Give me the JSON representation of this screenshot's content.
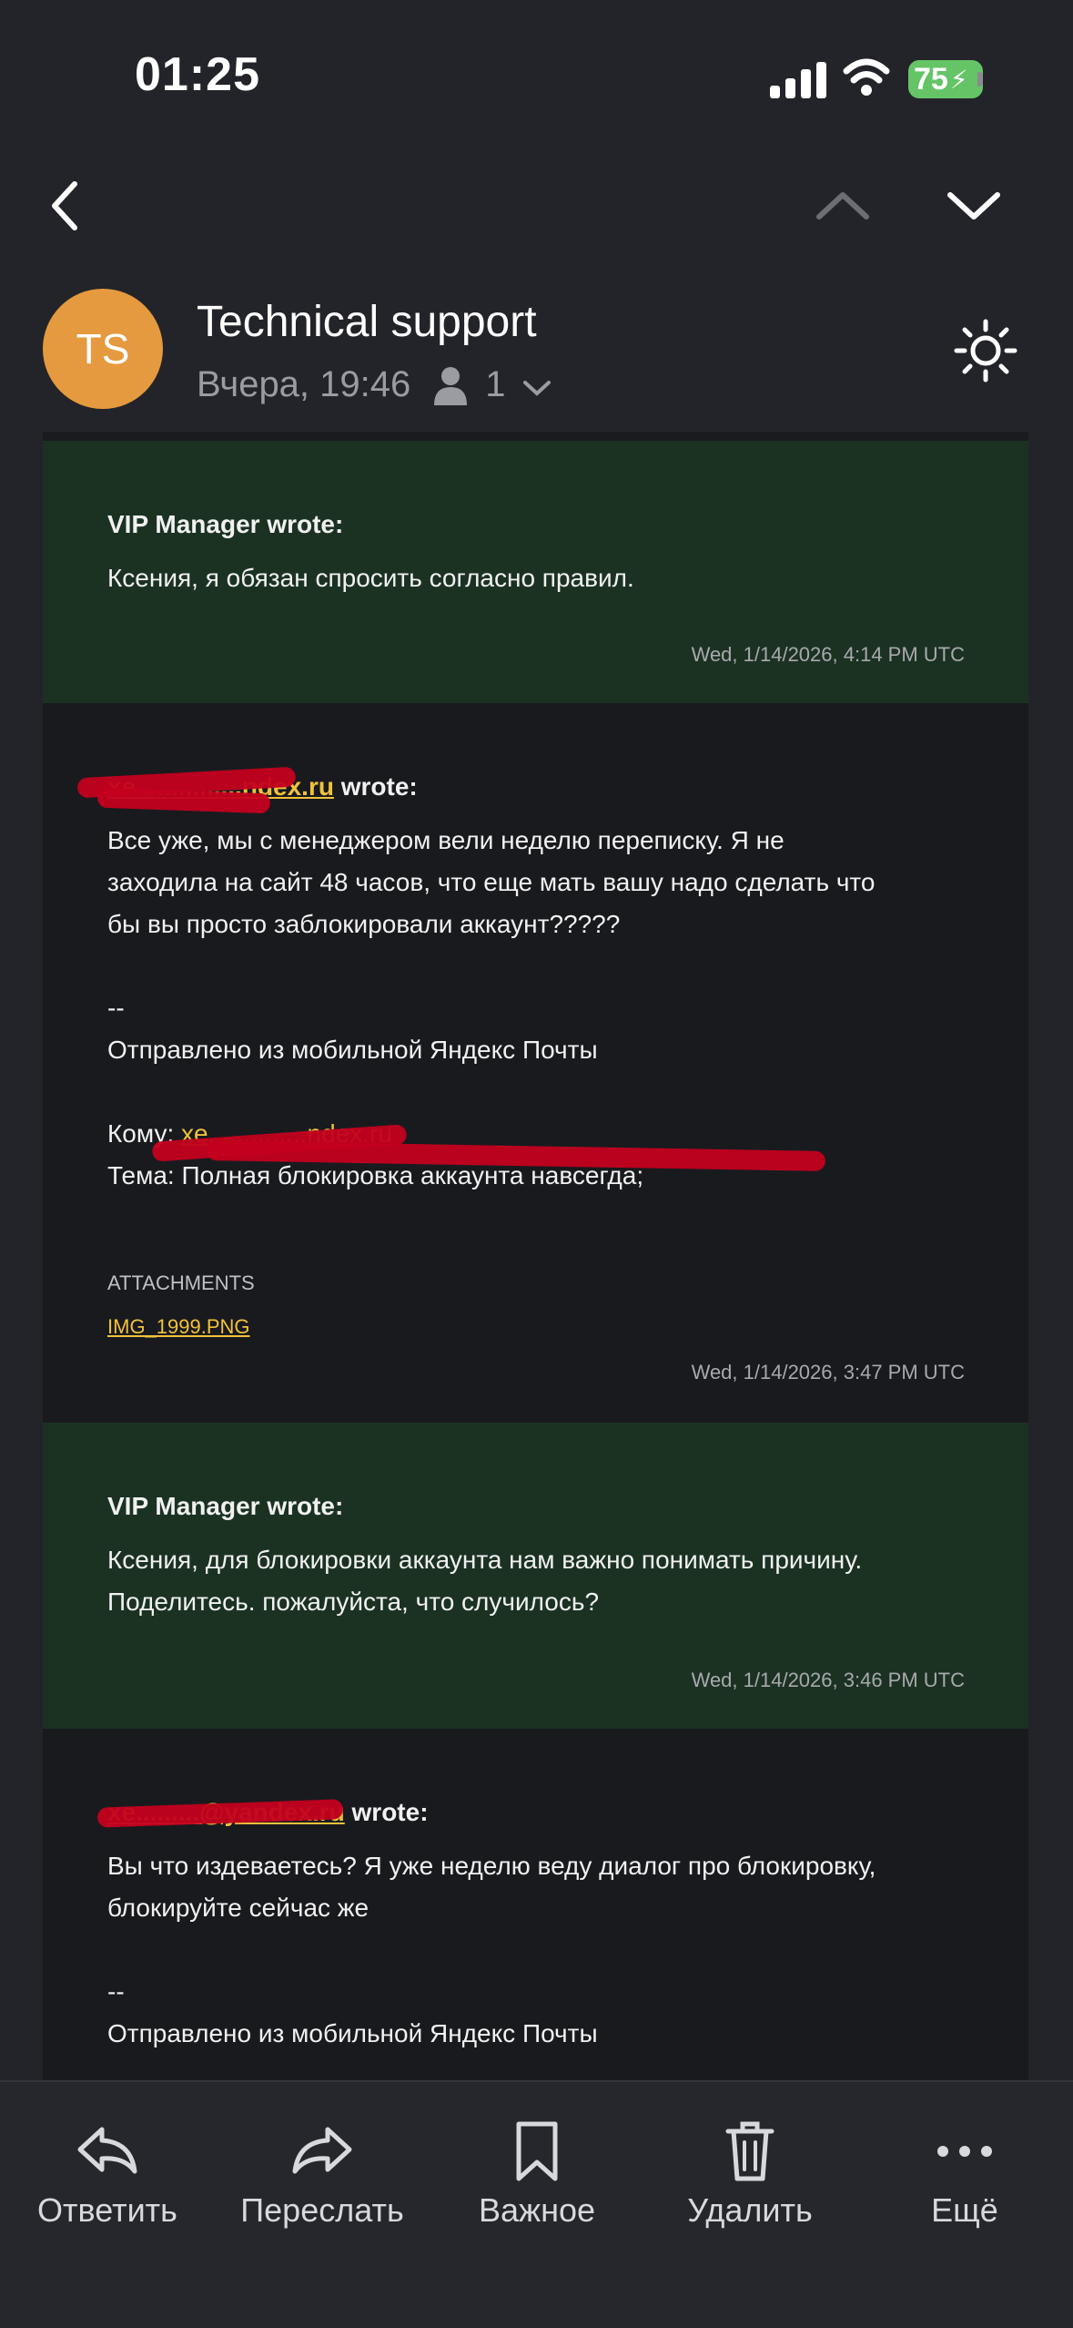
{
  "status_bar": {
    "time": "01:25",
    "battery": "75"
  },
  "header": {
    "avatar_initials": "TS",
    "sender": "Technical support",
    "date": "Вчера, 19:46",
    "recipients_count": "1"
  },
  "messages": [
    {
      "author": "VIP Manager wrote:",
      "text": [
        "Ксения, я обязан спросить согласно правил."
      ],
      "date": "Wed, 1/14/2026, 4:14 PM UTC"
    },
    {
      "author_email": "xe...............ndex.ru",
      "author_suffix": " wrote:",
      "text": [
        "Все уже, мы с менеджером вели неделю переписку. Я не",
        "заходила на сайт 48 часов, что еще мать вашу надо сделать что",
        "бы вы просто заблокировали аккаунт?????"
      ],
      "signature_sep": "--",
      "signature": "Отправлено из мобильной Яндекс Почты",
      "to_label": "Кому:",
      "to_value": "xe..............ndex.ru",
      "subject": "Тема: Полная блокировка аккаунта навсегда;",
      "attachments_title": "ATTACHMENTS",
      "attachment": "IMG_1999.PNG",
      "date": "Wed, 1/14/2026, 3:47 PM UTC"
    },
    {
      "author": "VIP Manager wrote:",
      "text": [
        "Ксения, для блокировки аккаунта нам важно понимать причину.",
        "Поделитесь. пожалуйста, что случилось?"
      ],
      "date": "Wed, 1/14/2026, 3:46 PM UTC"
    },
    {
      "author_email": "xe.........@yandex.ru",
      "author_suffix": " wrote:",
      "text": [
        "Вы что издеваетесь? Я уже неделю веду диалог про блокировку,",
        "блокируйте сейчас же"
      ],
      "signature_sep": "--",
      "signature": "Отправлено из мобильной Яндекс Почты"
    }
  ],
  "actions": [
    {
      "label": "Ответить",
      "icon": "reply-icon"
    },
    {
      "label": "Переслать",
      "icon": "forward-icon"
    },
    {
      "label": "Важное",
      "icon": "bookmark-icon"
    },
    {
      "label": "Удалить",
      "icon": "trash-icon"
    },
    {
      "label": "Ещё",
      "icon": "more-icon"
    }
  ],
  "colors": {
    "background": "#232429",
    "green_message": "#1b3223",
    "dark_message": "#191a1e",
    "link": "#f0c23a",
    "avatar": "#e59a3f"
  }
}
